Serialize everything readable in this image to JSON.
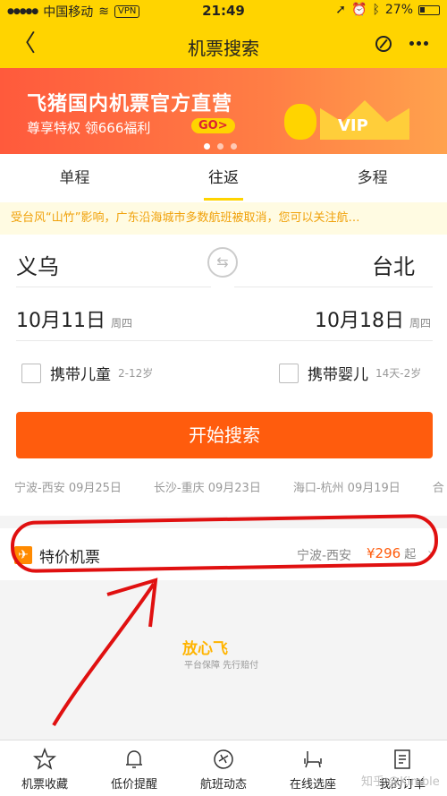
{
  "statusbar": {
    "carrier": "中国移动",
    "vpn": "VPN",
    "time": "21:49",
    "battery": "27%",
    "battery_level": 0.27
  },
  "nav": {
    "title": "机票搜索"
  },
  "banner": {
    "title": "飞猪国内机票官方直营",
    "subtitle": "尊享特权  领666福利",
    "go": "GO>",
    "vip": "VIP"
  },
  "tabs": [
    {
      "label": "单程"
    },
    {
      "label": "往返"
    },
    {
      "label": "多程"
    }
  ],
  "notice": "受台风“山竹”影响，广东沿海城市多数航班被取消，您可以关注航…",
  "form": {
    "from_city": "义乌",
    "to_city": "台北",
    "from_date": "10月11日",
    "from_weekday": "周四",
    "to_date": "10月18日",
    "to_weekday": "周四",
    "child_label": "携带儿童",
    "child_age": "2-12岁",
    "infant_label": "携带婴儿",
    "infant_age": "14天-2岁",
    "search_label": "开始搜索"
  },
  "history": [
    "宁波-西安 09月25日",
    "长沙-重庆 09月23日",
    "海口-杭州 09月19日",
    "合"
  ],
  "deal": {
    "title": "特价机票",
    "route": "宁波-西安",
    "price": "¥296",
    "suffix": "起"
  },
  "brand": {
    "logo": "放心飞",
    "sub": "平台保障 先行赔付"
  },
  "bottom_nav": [
    {
      "label": "机票收藏",
      "icon": "star-icon"
    },
    {
      "label": "低价提醒",
      "icon": "bell-icon"
    },
    {
      "label": "航班动态",
      "icon": "plane-circle-icon"
    },
    {
      "label": "在线选座",
      "icon": "seat-icon"
    },
    {
      "label": "我的订单",
      "icon": "order-icon"
    }
  ],
  "watermark": "知乎 @Kimble"
}
